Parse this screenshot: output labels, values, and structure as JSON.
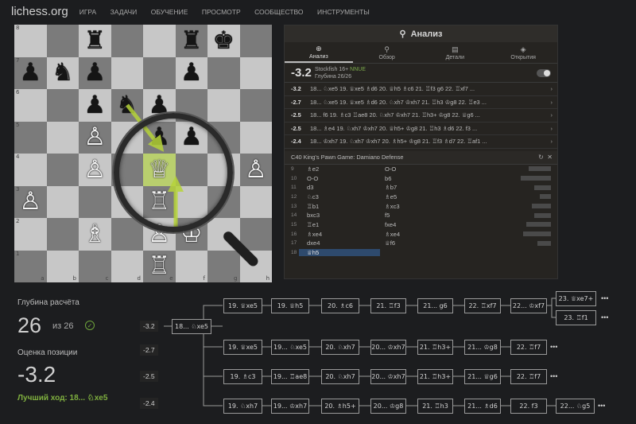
{
  "app": {
    "logo": "lichess.org"
  },
  "nav": [
    "ИГРА",
    "ЗАДАЧИ",
    "ОБУЧЕНИЕ",
    "ПРОСМОТР",
    "СООБЩЕСТВО",
    "ИНСТРУМЕНТЫ"
  ],
  "board": {
    "ranks": [
      "8",
      "7",
      "6",
      "5",
      "4",
      "3",
      "2",
      "1"
    ],
    "files": [
      "a",
      "b",
      "c",
      "d",
      "e",
      "f",
      "g",
      "h"
    ],
    "rows": [
      [
        "",
        "",
        "",
        "",
        "",
        "",
        "",
        ""
      ],
      [
        "",
        "",
        "",
        "",
        "",
        "",
        "",
        ""
      ],
      [
        "",
        "",
        "",
        "",
        "",
        "",
        "",
        ""
      ],
      [
        "",
        "",
        "",
        "",
        "",
        "",
        "",
        ""
      ],
      [
        "",
        "",
        "",
        "",
        "",
        "",
        "",
        ""
      ],
      [
        "",
        "",
        "",
        "",
        "",
        "",
        "",
        ""
      ],
      [
        "",
        "",
        "",
        "",
        "",
        "",
        "",
        ""
      ],
      [
        "",
        "",
        "",
        "",
        "",
        "",
        "",
        ""
      ]
    ]
  },
  "panel": {
    "title": "Анализ",
    "tabs": [
      {
        "label": "Анализ",
        "icon": "⊕"
      },
      {
        "label": "Обзор",
        "icon": "⚲"
      },
      {
        "label": "Детали",
        "icon": "▤"
      },
      {
        "label": "Открытия",
        "icon": "◈"
      }
    ],
    "engine": {
      "eval": "-3.2",
      "name": "Stockfish 16+",
      "nnue": "NNUE",
      "depth": "Глубина 26/26"
    },
    "lines": [
      {
        "eval": "-3.2",
        "moves": "18... ♘xe5 19. ♕xe5 ♗d6 20. ♕h5 ♗c6 21. ♖f3 g6 22. ♖xf7 ..."
      },
      {
        "eval": "-2.7",
        "moves": "18... ♘xe5 19. ♕xe5 ♗d6 20. ♘xh7 ♔xh7 21. ♖h3 ♔g8 22. ♖e3 ..."
      },
      {
        "eval": "-2.5",
        "moves": "18... f6 19. ♗c3 ♖ae8 20. ♘xh7 ♔xh7 21. ♖h3+ ♔g8 22. ♕g6 ..."
      },
      {
        "eval": "-2.5",
        "moves": "18... ♗e4 19. ♘xh7 ♔xh7 20. ♕h5+ ♔g8 21. ♖h3 ♗d6 22. f3 ..."
      },
      {
        "eval": "-2.4",
        "moves": "18... ♔xh7 19. ♘xh7 ♔xh7 20. ♗h5+ ♔g8 21. ♖f3 ♗d7 22. ♖af1 ..."
      }
    ],
    "opening": "C40 King's Pawn Game: Damiano Defense",
    "moves": [
      {
        "n": "9",
        "w": "♗e2",
        "b": "O-O",
        "bar": 40
      },
      {
        "n": "10",
        "w": "O-O",
        "b": "b6",
        "bar": 55
      },
      {
        "n": "11",
        "w": "d3",
        "b": "♗b7",
        "bar": 30
      },
      {
        "n": "12",
        "w": "♘c3",
        "b": "♗e5",
        "bar": 20
      },
      {
        "n": "13",
        "w": "♖b1",
        "b": "♗xc3",
        "bar": 35
      },
      {
        "n": "14",
        "w": "bxc3",
        "b": "f5",
        "bar": 30
      },
      {
        "n": "15",
        "w": "♖e1",
        "b": "fxe4",
        "bar": 45
      },
      {
        "n": "16",
        "w": "♗xe4",
        "b": "♗xe4",
        "bar": 50
      },
      {
        "n": "17",
        "w": "dxe4",
        "b": "♕f6",
        "bar": 25
      },
      {
        "n": "18",
        "w": "♕h5",
        "b": "",
        "bar": 0
      }
    ]
  },
  "stats": {
    "depth_label": "Глубина расчёта",
    "depth": "26",
    "depth_of": "из 26",
    "check": "✓",
    "eval_label": "Оценка позиции",
    "eval": "-3.2",
    "best_move": "Лучший ход: 18... ♘xe5"
  },
  "tree": {
    "evals": [
      "-3.2",
      "-2.7",
      "-2.5",
      "-2.4"
    ],
    "root": "18... ♘xe5",
    "line1": [
      "19. ♕xe5",
      "19. ♕h5",
      "20. ♗c6",
      "21. ♖f3",
      "21... g6",
      "22. ♖xf7",
      "22... ♔xf7"
    ],
    "line1_tail": [
      "23. ♕xe7+",
      "23. ♖f1"
    ],
    "line2": [
      "19. ♕xe5",
      "19... ♘xe5",
      "20. ♘xh7",
      "20... ♔xh7",
      "21. ♖h3+",
      "21... ♔g8",
      "22. ♖f7"
    ],
    "line3": [
      "19. ♗c3",
      "19... ♖ae8",
      "20. ♘xh7",
      "20... ♔xh7",
      "21. ♖h3+",
      "21... ♕g6",
      "22. ♖f7"
    ],
    "line4": [
      "19. ♘xh7",
      "19... ♔xh7",
      "20. ♗h5+",
      "20... ♔g8",
      "21. ♖h3",
      "21... ♗d6",
      "22. f3",
      "22... ♘g5"
    ],
    "more": "•••"
  }
}
